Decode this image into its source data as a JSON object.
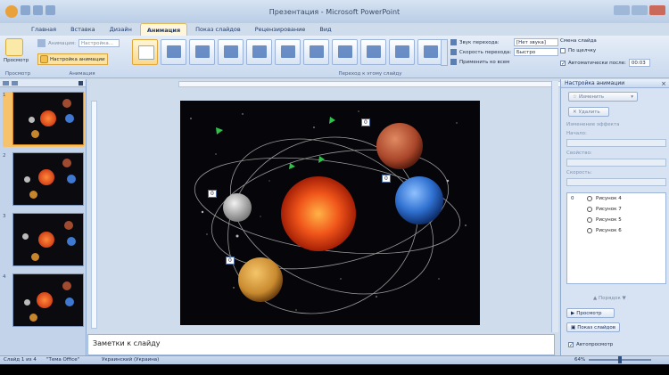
{
  "window": {
    "title": "Презентация - Microsoft PowerPoint"
  },
  "ribbon_tabs": [
    {
      "label": "Главная"
    },
    {
      "label": "Вставка"
    },
    {
      "label": "Дизайн"
    },
    {
      "label": "Анимация",
      "active": true
    },
    {
      "label": "Показ слайдов"
    },
    {
      "label": "Рецензирование"
    },
    {
      "label": "Вид"
    }
  ],
  "ribbon": {
    "preview": {
      "label": "Просмотр",
      "group": "Просмотр"
    },
    "animation_group": {
      "animate_label": "Анимация:",
      "animate_value": "Настройка...",
      "custom_animation": "Настройка анимации",
      "group": "Анимация"
    },
    "transition_group": {
      "group": "Переход к этому слайду",
      "sound_label": "Звук перехода:",
      "sound_value": "[Нет звука]",
      "speed_label": "Скорость перехода:",
      "speed_value": "Быстро",
      "apply_all": "Применить ко всем",
      "advance_title": "Смена слайда",
      "on_click": "По щелчку",
      "auto_after": "Автоматически после:",
      "auto_time": "00:03"
    }
  },
  "slides": [
    {
      "number": "1"
    },
    {
      "number": "2"
    },
    {
      "number": "3"
    },
    {
      "number": "4"
    }
  ],
  "slide": {
    "markers": [
      "0",
      "0",
      "0",
      "0"
    ]
  },
  "notes": {
    "placeholder": "Заметки к слайду"
  },
  "animation_pane": {
    "title": "Настройка анимации",
    "close": "×",
    "change_button": "Изменить",
    "remove_button": "Удалить",
    "modify_label": "Изменение эффекта",
    "start_label": "Начало:",
    "property_label": "Свойство:",
    "speed_label": "Скорость:",
    "list_index": "0",
    "items": [
      "Рисунок 4",
      "Рисунок 7",
      "Рисунок 5",
      "Рисунок 6"
    ],
    "reorder_label": "Порядок",
    "play_button": "Просмотр",
    "slideshow_button": "Показ слайдов",
    "autopreview_label": "Автопросмотр"
  },
  "status": {
    "slide": "Слайд 1 из 4",
    "theme": "\"Тема Office\"",
    "language": "Украинский (Украина)",
    "zoom": "64%"
  },
  "colors": {
    "ribbon_bg": "#d5e2f2",
    "active_tab": "#fff6dc",
    "slide_bg": "#06060a",
    "sun": "#e8420f",
    "mars": "#b24a2e",
    "earth": "#2e6fcf",
    "venus": "#c98a2f",
    "moon": "#c8c8c8"
  }
}
